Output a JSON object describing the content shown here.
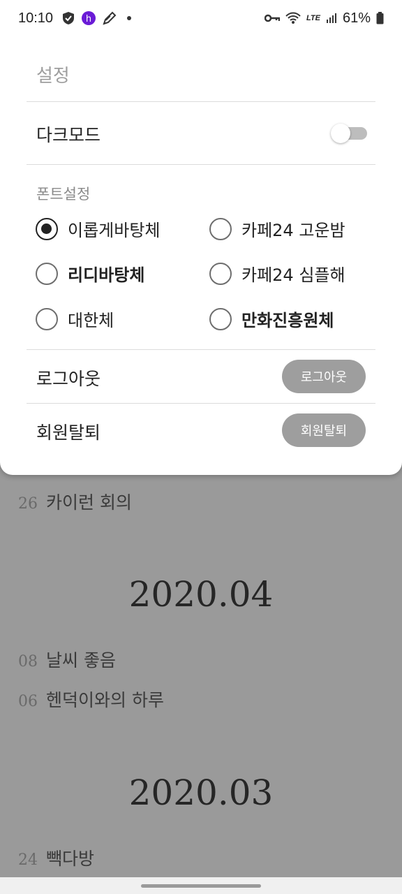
{
  "status_bar": {
    "time": "10:10",
    "battery": "61%",
    "network": "LTE"
  },
  "settings": {
    "title": "설정",
    "dark_mode_label": "다크모드",
    "dark_mode_on": false,
    "font_section_label": "폰트설정",
    "fonts": [
      {
        "label": "이롭게바탕체",
        "checked": true
      },
      {
        "label": "카페24 고운밤",
        "checked": false
      },
      {
        "label": "리디바탕체",
        "checked": false
      },
      {
        "label": "카페24 심플해",
        "checked": false
      },
      {
        "label": "대한체",
        "checked": false
      },
      {
        "label": "만화진흥원체",
        "checked": false
      }
    ],
    "logout_label": "로그아웃",
    "logout_button": "로그아웃",
    "withdraw_label": "회원탈퇴",
    "withdraw_button": "회원탈퇴"
  },
  "diary": {
    "entry_0": {
      "day": "26",
      "title": "카이런 회의"
    },
    "month_0": "2020.04",
    "entry_1": {
      "day": "08",
      "title": "날씨 좋음"
    },
    "entry_2": {
      "day": "06",
      "title": "헨덕이와의 하루"
    },
    "month_1": "2020.03",
    "entry_3": {
      "day": "24",
      "title": "빽다방"
    }
  },
  "colors": {
    "overlay": "#9a9a9a",
    "button_bg": "#9e9e9e",
    "text_primary": "#222222"
  }
}
